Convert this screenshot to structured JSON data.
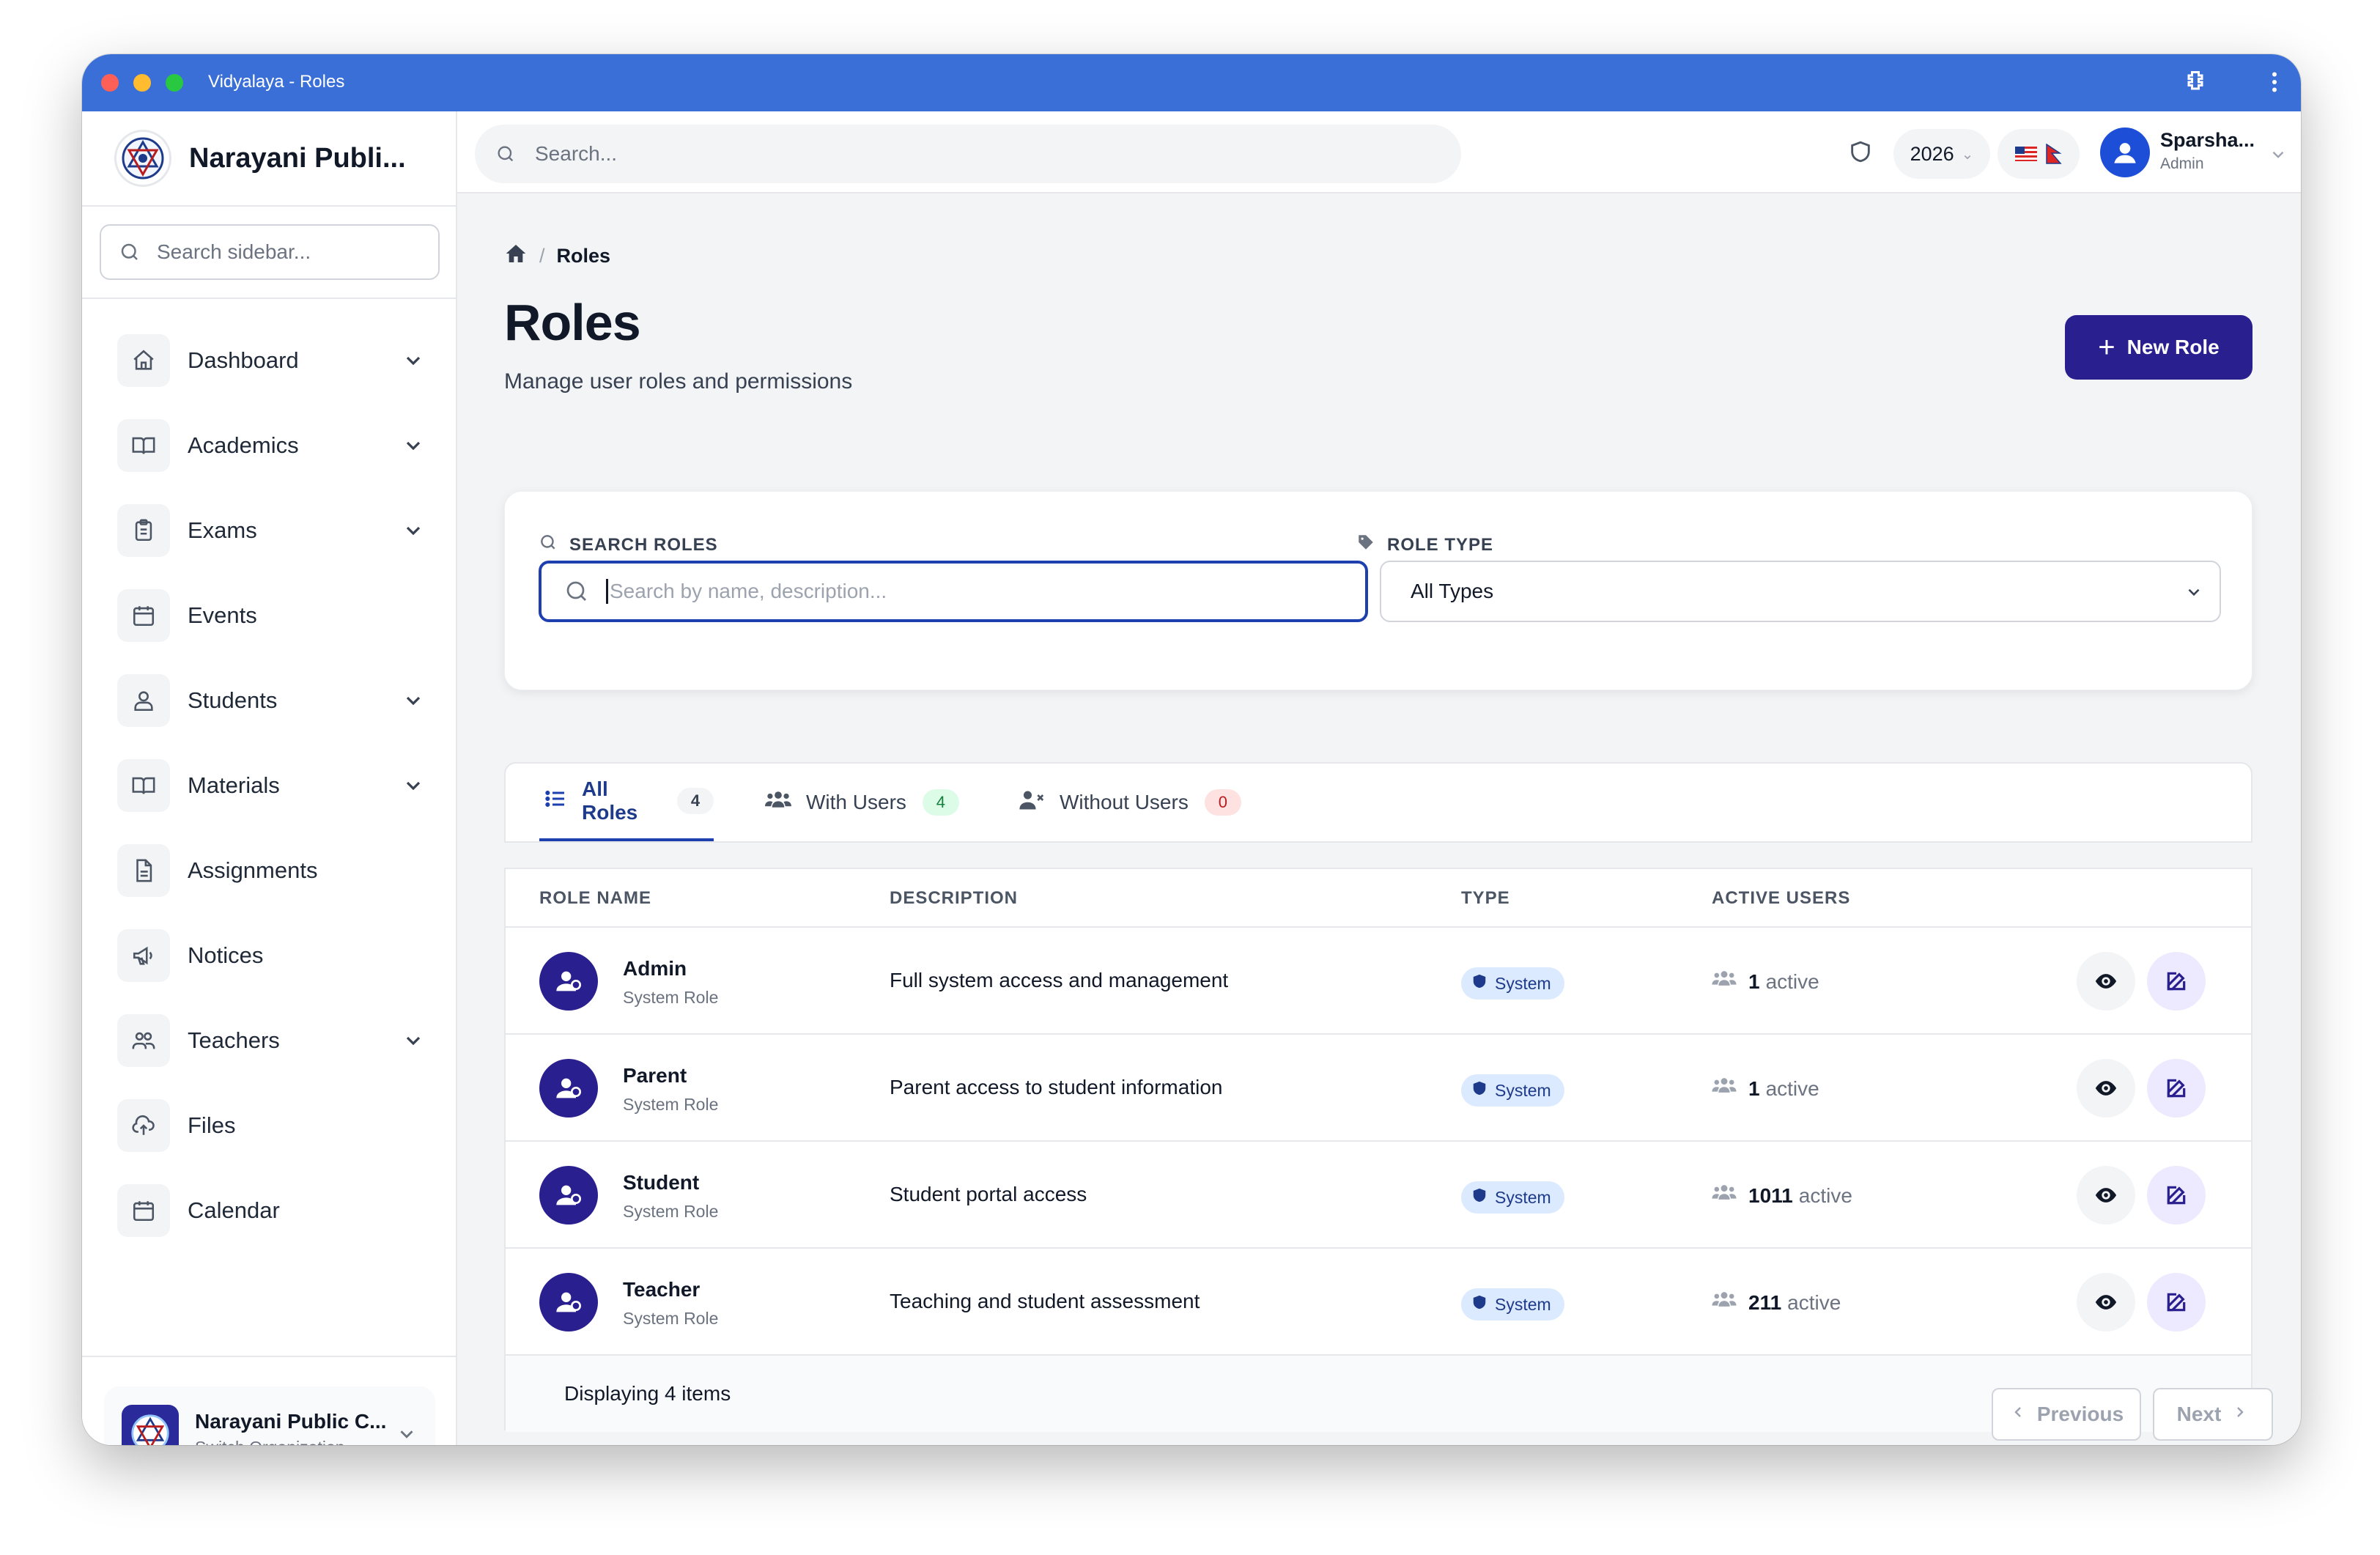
{
  "window": {
    "title": "Vidyalaya - Roles"
  },
  "sidebar": {
    "org_short": "Narayani Publi...",
    "search_placeholder": "Search sidebar...",
    "items": [
      {
        "label": "Dashboard",
        "icon": "home-icon",
        "chevron": true
      },
      {
        "label": "Academics",
        "icon": "book-icon",
        "chevron": true
      },
      {
        "label": "Exams",
        "icon": "clipboard-icon",
        "chevron": true
      },
      {
        "label": "Events",
        "icon": "calendar-icon",
        "chevron": false
      },
      {
        "label": "Students",
        "icon": "user-icon",
        "chevron": true
      },
      {
        "label": "Materials",
        "icon": "book-icon",
        "chevron": true
      },
      {
        "label": "Assignments",
        "icon": "document-icon",
        "chevron": false
      },
      {
        "label": "Notices",
        "icon": "megaphone-icon",
        "chevron": false
      },
      {
        "label": "Teachers",
        "icon": "users-icon",
        "chevron": true
      },
      {
        "label": "Files",
        "icon": "cloud-upload-icon",
        "chevron": false
      },
      {
        "label": "Calendar",
        "icon": "calendar-icon",
        "chevron": false
      }
    ],
    "org_switch": {
      "name": "Narayani Public C...",
      "sub": "Switch Organization"
    }
  },
  "header": {
    "search_placeholder": "Search...",
    "year": "2026",
    "user_name": "Sparsha...",
    "user_role": "Admin"
  },
  "breadcrumb": {
    "current": "Roles"
  },
  "page": {
    "title": "Roles",
    "subtitle": "Manage user roles and permissions",
    "new_button": "New Role"
  },
  "filters": {
    "search_label": "SEARCH ROLES",
    "search_placeholder": "Search by name, description...",
    "type_label": "ROLE TYPE",
    "type_value": "All Types"
  },
  "tabs": [
    {
      "label": "All Roles",
      "count": "4",
      "active": true,
      "count_bg": "#f3f4f6",
      "count_color": "#374151"
    },
    {
      "label": "With Users",
      "count": "4",
      "active": false,
      "count_bg": "#dcfce7",
      "count_color": "#15803d"
    },
    {
      "label": "Without Users",
      "count": "0",
      "active": false,
      "count_bg": "#fee2e2",
      "count_color": "#b91c1c"
    }
  ],
  "table": {
    "headers": {
      "name": "ROLE NAME",
      "description": "DESCRIPTION",
      "type": "TYPE",
      "users": "ACTIVE USERS"
    },
    "rows": [
      {
        "name": "Admin",
        "sub": "System Role",
        "description": "Full system access and management",
        "type": "System",
        "count": "1",
        "suffix": "active"
      },
      {
        "name": "Parent",
        "sub": "System Role",
        "description": "Parent access to student information",
        "type": "System",
        "count": "1",
        "suffix": "active"
      },
      {
        "name": "Student",
        "sub": "System Role",
        "description": "Student portal access",
        "type": "System",
        "count": "1011",
        "suffix": "active"
      },
      {
        "name": "Teacher",
        "sub": "System Role",
        "description": "Teaching and student assessment",
        "type": "System",
        "count": "211",
        "suffix": "active"
      }
    ],
    "footer": "Displaying 4 items",
    "prev": "Previous",
    "next": "Next"
  }
}
